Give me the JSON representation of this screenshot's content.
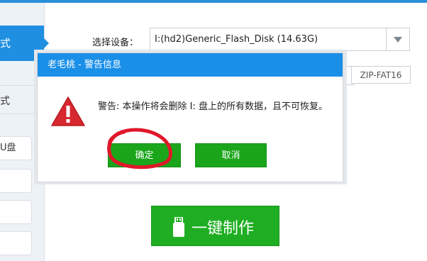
{
  "sidebar": {
    "active_label": "式",
    "item_text": "式",
    "buttons": [
      "U盘",
      "",
      "",
      ""
    ]
  },
  "device": {
    "label": "选择设备：",
    "selected": "I:(hd2)Generic_Flash_Disk (14.63G)"
  },
  "options": {
    "format_value": "ZIP-FAT16"
  },
  "dialog": {
    "title": "老毛桃 - 警告信息",
    "message": "警告: 本操作将会删除 I: 盘上的所有数据，且不可恢复。",
    "ok_label": "确定",
    "cancel_label": "取消"
  },
  "main_button": {
    "label": "一键制作"
  },
  "colors": {
    "accent_blue": "#1a8fe8",
    "button_green": "#1aa51a",
    "warning_red": "#d7282f",
    "annotation_red": "#e0182a"
  },
  "icons": [
    "warning-triangle-icon",
    "usb-icon",
    "dropdown-arrow-icon"
  ]
}
